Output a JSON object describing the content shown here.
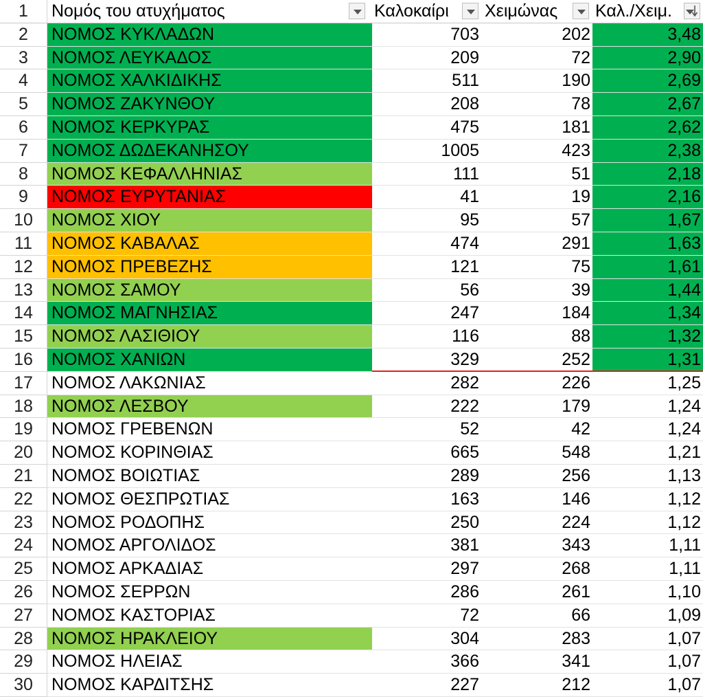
{
  "colors": {
    "dark_green": "#00b050",
    "light_green": "#92d050",
    "red": "#ff0000",
    "orange": "#ffc000",
    "separator_line": "#e02020"
  },
  "header": {
    "row_number": "1",
    "name": "Νομός του ατυχήματος",
    "summer": "Καλοκαίρι",
    "winter": "Χειμώνας",
    "ratio": "Καλ./Χειμ.",
    "filter_icon": "dropdown-arrow",
    "sort_icon": "sort-descending"
  },
  "rows": [
    {
      "n": "2",
      "name": "ΝΟΜΟΣ ΚΥΚΛΑΔΩΝ",
      "summer": "703",
      "winter": "202",
      "ratio": "3,48",
      "name_fill": "dark_green",
      "ratio_fill": "dark_green"
    },
    {
      "n": "3",
      "name": "ΝΟΜΟΣ ΛΕΥΚΑΔΟΣ",
      "summer": "209",
      "winter": "72",
      "ratio": "2,90",
      "name_fill": "dark_green",
      "ratio_fill": "dark_green"
    },
    {
      "n": "4",
      "name": "ΝΟΜΟΣ ΧΑΛΚΙΔΙΚΗΣ",
      "summer": "511",
      "winter": "190",
      "ratio": "2,69",
      "name_fill": "dark_green",
      "ratio_fill": "dark_green"
    },
    {
      "n": "5",
      "name": "ΝΟΜΟΣ ΖΑΚΥΝΘΟΥ",
      "summer": "208",
      "winter": "78",
      "ratio": "2,67",
      "name_fill": "dark_green",
      "ratio_fill": "dark_green"
    },
    {
      "n": "6",
      "name": "ΝΟΜΟΣ ΚΕΡΚΥΡΑΣ",
      "summer": "475",
      "winter": "181",
      "ratio": "2,62",
      "name_fill": "dark_green",
      "ratio_fill": "dark_green"
    },
    {
      "n": "7",
      "name": "ΝΟΜΟΣ ΔΩΔΕΚΑΝΗΣΟΥ",
      "summer": "1005",
      "winter": "423",
      "ratio": "2,38",
      "name_fill": "dark_green",
      "ratio_fill": "dark_green"
    },
    {
      "n": "8",
      "name": "ΝΟΜΟΣ ΚΕΦΑΛΛΗΝΙΑΣ",
      "summer": "111",
      "winter": "51",
      "ratio": "2,18",
      "name_fill": "light_green",
      "ratio_fill": "dark_green"
    },
    {
      "n": "9",
      "name": "ΝΟΜΟΣ ΕΥΡΥΤΑΝΙΑΣ",
      "summer": "41",
      "winter": "19",
      "ratio": "2,16",
      "name_fill": "red",
      "ratio_fill": "dark_green"
    },
    {
      "n": "10",
      "name": "ΝΟΜΟΣ ΧΙΟΥ",
      "summer": "95",
      "winter": "57",
      "ratio": "1,67",
      "name_fill": "light_green",
      "ratio_fill": "dark_green"
    },
    {
      "n": "11",
      "name": "ΝΟΜΟΣ ΚΑΒΑΛΑΣ",
      "summer": "474",
      "winter": "291",
      "ratio": "1,63",
      "name_fill": "orange",
      "ratio_fill": "dark_green"
    },
    {
      "n": "12",
      "name": "ΝΟΜΟΣ ΠΡΕΒΕΖΗΣ",
      "summer": "121",
      "winter": "75",
      "ratio": "1,61",
      "name_fill": "orange",
      "ratio_fill": "dark_green"
    },
    {
      "n": "13",
      "name": "ΝΟΜΟΣ ΣΑΜΟΥ",
      "summer": "56",
      "winter": "39",
      "ratio": "1,44",
      "name_fill": "light_green",
      "ratio_fill": "dark_green"
    },
    {
      "n": "14",
      "name": "ΝΟΜΟΣ ΜΑΓΝΗΣΙΑΣ",
      "summer": "247",
      "winter": "184",
      "ratio": "1,34",
      "name_fill": "dark_green",
      "ratio_fill": "dark_green"
    },
    {
      "n": "15",
      "name": "ΝΟΜΟΣ ΛΑΣΙΘΙΟΥ",
      "summer": "116",
      "winter": "88",
      "ratio": "1,32",
      "name_fill": "light_green",
      "ratio_fill": "dark_green"
    },
    {
      "n": "16",
      "name": "ΝΟΜΟΣ ΧΑΝΙΩΝ",
      "summer": "329",
      "winter": "252",
      "ratio": "1,31",
      "name_fill": "dark_green",
      "ratio_fill": "dark_green"
    },
    {
      "n": "17",
      "name": "ΝΟΜΟΣ ΛΑΚΩΝΙΑΣ",
      "summer": "282",
      "winter": "226",
      "ratio": "1,25",
      "name_fill": "",
      "ratio_fill": ""
    },
    {
      "n": "18",
      "name": "ΝΟΜΟΣ ΛΕΣΒΟΥ",
      "summer": "222",
      "winter": "179",
      "ratio": "1,24",
      "name_fill": "light_green",
      "ratio_fill": ""
    },
    {
      "n": "19",
      "name": "ΝΟΜΟΣ ΓΡΕΒΕΝΩΝ",
      "summer": "52",
      "winter": "42",
      "ratio": "1,24",
      "name_fill": "",
      "ratio_fill": ""
    },
    {
      "n": "20",
      "name": "ΝΟΜΟΣ ΚΟΡΙΝΘΙΑΣ",
      "summer": "665",
      "winter": "548",
      "ratio": "1,21",
      "name_fill": "",
      "ratio_fill": ""
    },
    {
      "n": "21",
      "name": "ΝΟΜΟΣ ΒΟΙΩΤΙΑΣ",
      "summer": "289",
      "winter": "256",
      "ratio": "1,13",
      "name_fill": "",
      "ratio_fill": ""
    },
    {
      "n": "22",
      "name": "ΝΟΜΟΣ ΘΕΣΠΡΩΤΙΑΣ",
      "summer": "163",
      "winter": "146",
      "ratio": "1,12",
      "name_fill": "",
      "ratio_fill": ""
    },
    {
      "n": "23",
      "name": "ΝΟΜΟΣ ΡΟΔΟΠΗΣ",
      "summer": "250",
      "winter": "224",
      "ratio": "1,12",
      "name_fill": "",
      "ratio_fill": ""
    },
    {
      "n": "24",
      "name": "ΝΟΜΟΣ ΑΡΓΟΛΙΔΟΣ",
      "summer": "381",
      "winter": "343",
      "ratio": "1,11",
      "name_fill": "",
      "ratio_fill": ""
    },
    {
      "n": "25",
      "name": "ΝΟΜΟΣ ΑΡΚΑΔΙΑΣ",
      "summer": "297",
      "winter": "268",
      "ratio": "1,11",
      "name_fill": "",
      "ratio_fill": ""
    },
    {
      "n": "26",
      "name": "ΝΟΜΟΣ ΣΕΡΡΩΝ",
      "summer": "286",
      "winter": "261",
      "ratio": "1,10",
      "name_fill": "",
      "ratio_fill": ""
    },
    {
      "n": "27",
      "name": "ΝΟΜΟΣ ΚΑΣΤΟΡΙΑΣ",
      "summer": "72",
      "winter": "66",
      "ratio": "1,09",
      "name_fill": "",
      "ratio_fill": ""
    },
    {
      "n": "28",
      "name": "ΝΟΜΟΣ ΗΡΑΚΛΕΙΟΥ",
      "summer": "304",
      "winter": "283",
      "ratio": "1,07",
      "name_fill": "light_green",
      "ratio_fill": ""
    },
    {
      "n": "29",
      "name": "ΝΟΜΟΣ ΗΛΕΙΑΣ",
      "summer": "366",
      "winter": "341",
      "ratio": "1,07",
      "name_fill": "",
      "ratio_fill": ""
    },
    {
      "n": "30",
      "name": "ΝΟΜΟΣ ΚΑΡΔΙΤΣΗΣ",
      "summer": "227",
      "winter": "212",
      "ratio": "1,07",
      "name_fill": "",
      "ratio_fill": ""
    }
  ]
}
